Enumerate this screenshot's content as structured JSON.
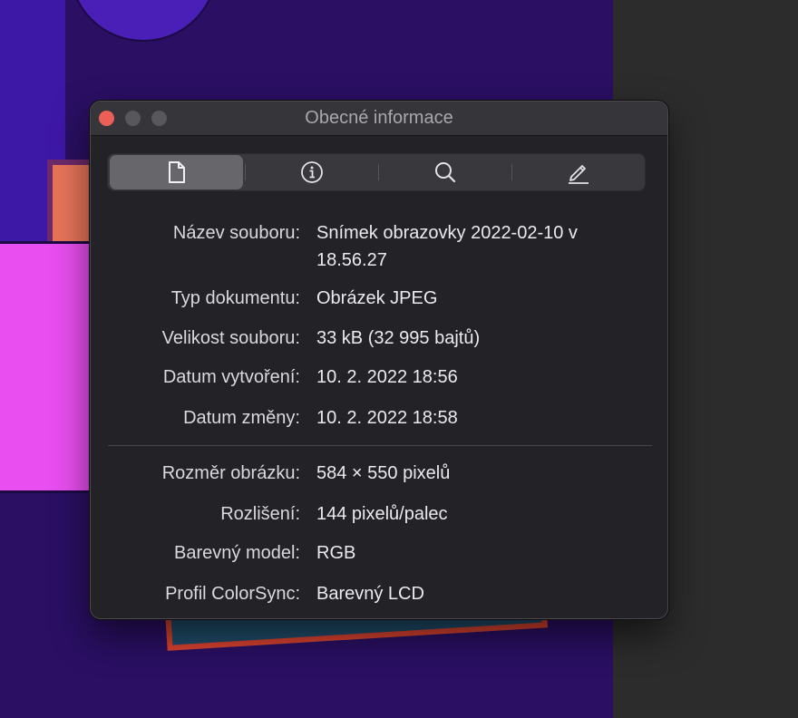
{
  "window": {
    "title": "Obecné informace"
  },
  "toolbar": {
    "tabs": [
      {
        "icon": "document-icon",
        "active": true
      },
      {
        "icon": "info-icon",
        "active": false
      },
      {
        "icon": "magnifier-icon",
        "active": false
      },
      {
        "icon": "pencil-icon",
        "active": false
      }
    ]
  },
  "info": {
    "name_label": "Název souboru:",
    "name_value": "Snímek obrazovky 2022-02-10 v 18.56.27",
    "type_label": "Typ dokumentu:",
    "type_value": "Obrázek JPEG",
    "size_label": "Velikost souboru:",
    "size_value": "33 kB (32 995 bajtů)",
    "created_label": "Datum vytvoření:",
    "created_value": "10. 2. 2022 18:56",
    "modified_label": "Datum změny:",
    "modified_value": "10. 2. 2022 18:58",
    "dimensions_label": "Rozměr obrázku:",
    "dimensions_value": "584 × 550 pixelů",
    "resolution_label": "Rozlišení:",
    "resolution_value": "144 pixelů/palec",
    "colormodel_label": "Barevný model:",
    "colormodel_value": "RGB",
    "profile_label": "Profil ColorSync:",
    "profile_value": "Barevný LCD"
  },
  "colors": {
    "close_button": "#ec5f57",
    "window_bg": "#232227",
    "titlebar_bg": "#36353a"
  }
}
